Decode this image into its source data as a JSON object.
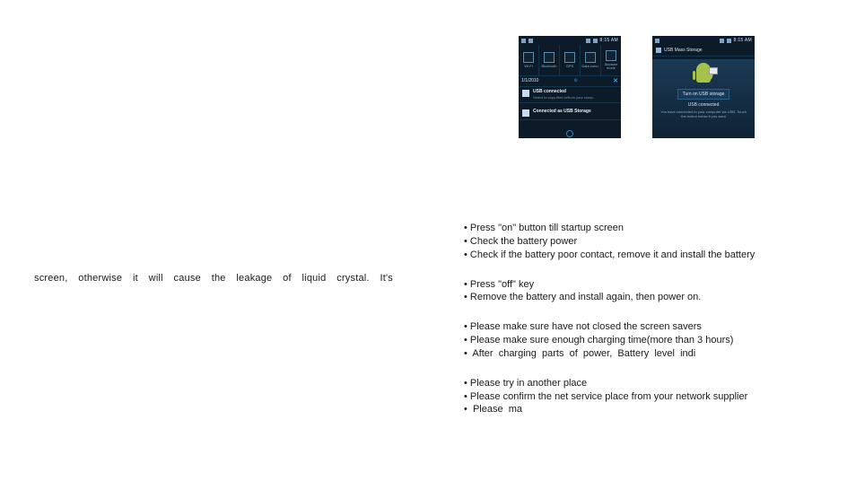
{
  "left": {
    "text": "screen, otherwise it will cause the leakage of liquid crystal. It's"
  },
  "right": {
    "groups": [
      {
        "lines": [
          "• Press \"on\" button till startup screen",
          "• Check the battery power",
          "• Check if the battery poor contact, remove it and install the battery"
        ]
      },
      {
        "lines": [
          "• Press \"off\" key",
          "• Remove the battery and install again, then power on."
        ]
      },
      {
        "lines": [
          "• Please make sure have not closed the screen savers",
          "• Please make sure enough charging time(more than 3 hours)",
          "•  After  charging  parts  of  power,  Battery  level  indi"
        ]
      },
      {
        "lines": [
          "• Please try in another place",
          "• Please confirm the net service place from your network supplier",
          "•  Please  ma"
        ]
      }
    ]
  },
  "phone1": {
    "clock": "8:15 AM",
    "tiles": [
      {
        "label": "Wi-Fi"
      },
      {
        "label": "Bluetooth"
      },
      {
        "label": "GPS"
      },
      {
        "label": "Data\nconn."
      },
      {
        "label": "Airplane\nmode"
      }
    ],
    "date": "1/1/2010",
    "close_glyph": "✕",
    "row1": {
      "title": "USB connected",
      "sub": "Select to copy files to/from your comp…"
    },
    "row2": {
      "title": "Connected as USB Storage"
    }
  },
  "phone2": {
    "clock": "8:15 AM",
    "title": "USB Mass Storage",
    "button": "Turn on USB storage",
    "heading": "USB connected",
    "sub": "You have connected to your computer via USB. Touch the button below if you want"
  }
}
